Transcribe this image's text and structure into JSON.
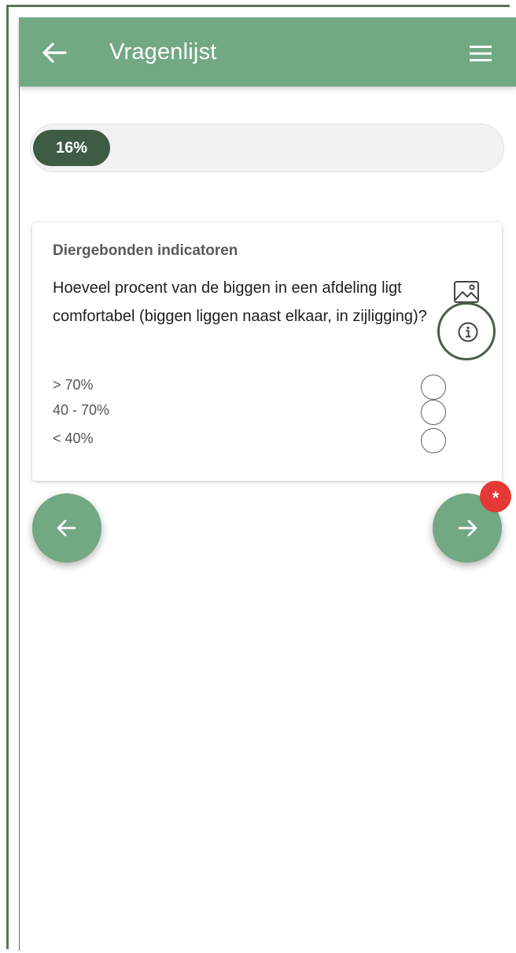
{
  "header": {
    "title": "Vragenlijst",
    "back_icon": "arrow-left-icon",
    "menu_icon": "menu-icon"
  },
  "progress": {
    "percent": 16,
    "label": "16%"
  },
  "question_card": {
    "section": "Diergebonden indicatoren",
    "question": "Hoeveel procent van de biggen in een afdeling ligt comfortabel (biggen liggen naast elkaar, in zijligging)?",
    "options": [
      {
        "label": "> 70%",
        "selected": false
      },
      {
        "label": "40 - 70%",
        "selected": false
      },
      {
        "label": "< 40%",
        "selected": false
      }
    ]
  },
  "navigation": {
    "prev_icon": "arrow-left-icon",
    "next_icon": "arrow-right-icon",
    "required_badge": "*"
  },
  "colors": {
    "accent": "#72a883",
    "progress": "#3e5c45",
    "badge": "#e53935"
  }
}
